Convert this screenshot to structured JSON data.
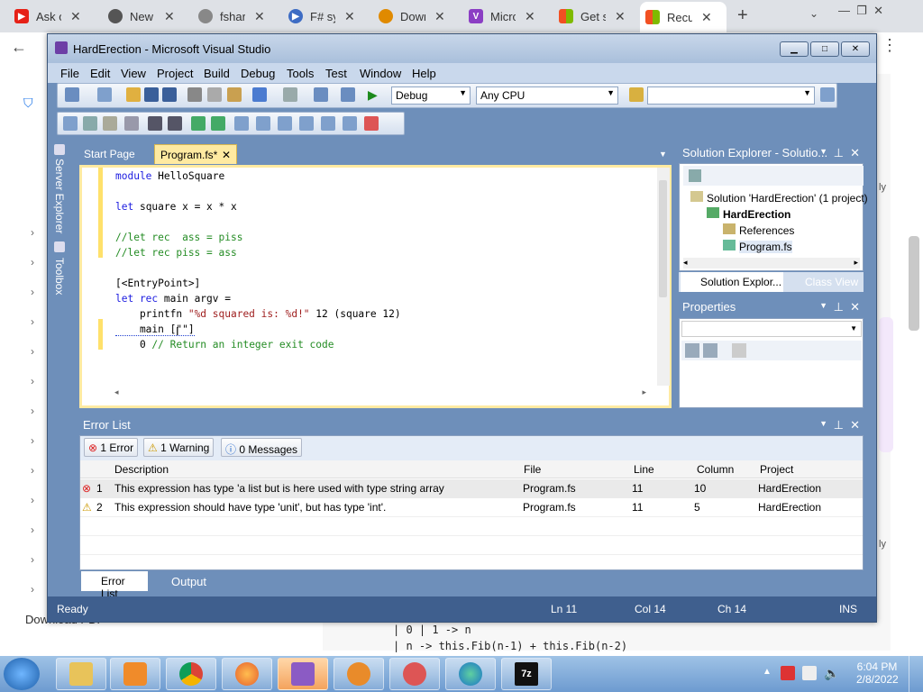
{
  "browser": {
    "tabs": [
      {
        "label": "Ask or",
        "color": "#e62117"
      },
      {
        "label": "New T",
        "color": "#444444"
      },
      {
        "label": "fsharp",
        "color": "#666666"
      },
      {
        "label": "F# syn",
        "color": "#3d6cc4"
      },
      {
        "label": "Downl",
        "color": "#e08a00"
      },
      {
        "label": "Micro",
        "color": "#8b3ec4"
      },
      {
        "label": "Get sta",
        "color": "#f25022"
      },
      {
        "label": "Recurs",
        "color": "#f25022"
      }
    ],
    "new_tab_label": "+",
    "page_fragments": {
      "download_pdf": "Download PDF",
      "code1": "| 0 | 1 -> n",
      "code2": "| n -> this.Fib(n-1) + this.Fib(n-2)"
    }
  },
  "vs": {
    "title": "HardErection - Microsoft Visual Studio",
    "menu": [
      "File",
      "Edit",
      "View",
      "Project",
      "Build",
      "Debug",
      "Tools",
      "Test",
      "Window",
      "Help"
    ],
    "config": "Debug",
    "platform": "Any CPU",
    "side_tabs": [
      "Server Explorer",
      "Toolbox"
    ],
    "doc_tabs": {
      "start": "Start Page",
      "active": "Program.fs*",
      "close": "✕"
    },
    "code_lines": [
      "module HelloSquare",
      "",
      "let square x = x * x",
      "",
      "//let rec  ass = piss",
      "//let rec piss = ass",
      "",
      "[<EntryPoint>]",
      "let rec main argv =",
      "    printfn \"%d squared is: %d!\" 12 (square 12)",
      "    main [\"\"]",
      "    0 // Return an integer exit code"
    ],
    "solution_explorer": {
      "title": "Solution Explorer - Solutio...",
      "solution": "Solution 'HardErection' (1 project)",
      "project": "HardErection",
      "references": "References",
      "file": "Program.fs",
      "tab1": "Solution Explor...",
      "tab2": "Class View"
    },
    "properties": {
      "title": "Properties"
    },
    "error_list": {
      "title": "Error List",
      "errors_btn": "1 Error",
      "warnings_btn": "1 Warning",
      "messages_btn": "0 Messages",
      "columns": [
        "Description",
        "File",
        "Line",
        "Column",
        "Project"
      ],
      "rows": [
        {
          "num": "1",
          "desc": "This expression has type  'a list but is here used with type  string array",
          "file": "Program.fs",
          "line": "11",
          "col": "10",
          "project": "HardErection"
        },
        {
          "num": "2",
          "desc": "This expression should have type 'unit', but has type 'int'.",
          "file": "Program.fs",
          "line": "11",
          "col": "5",
          "project": "HardErection"
        }
      ],
      "tab_error": "Error List",
      "tab_output": "Output"
    },
    "status": {
      "ready": "Ready",
      "ln": "Ln 11",
      "col": "Col 14",
      "ch": "Ch 14",
      "ins": "INS"
    }
  },
  "taskbar": {
    "time": "6:04 PM",
    "date": "2/8/2022"
  }
}
